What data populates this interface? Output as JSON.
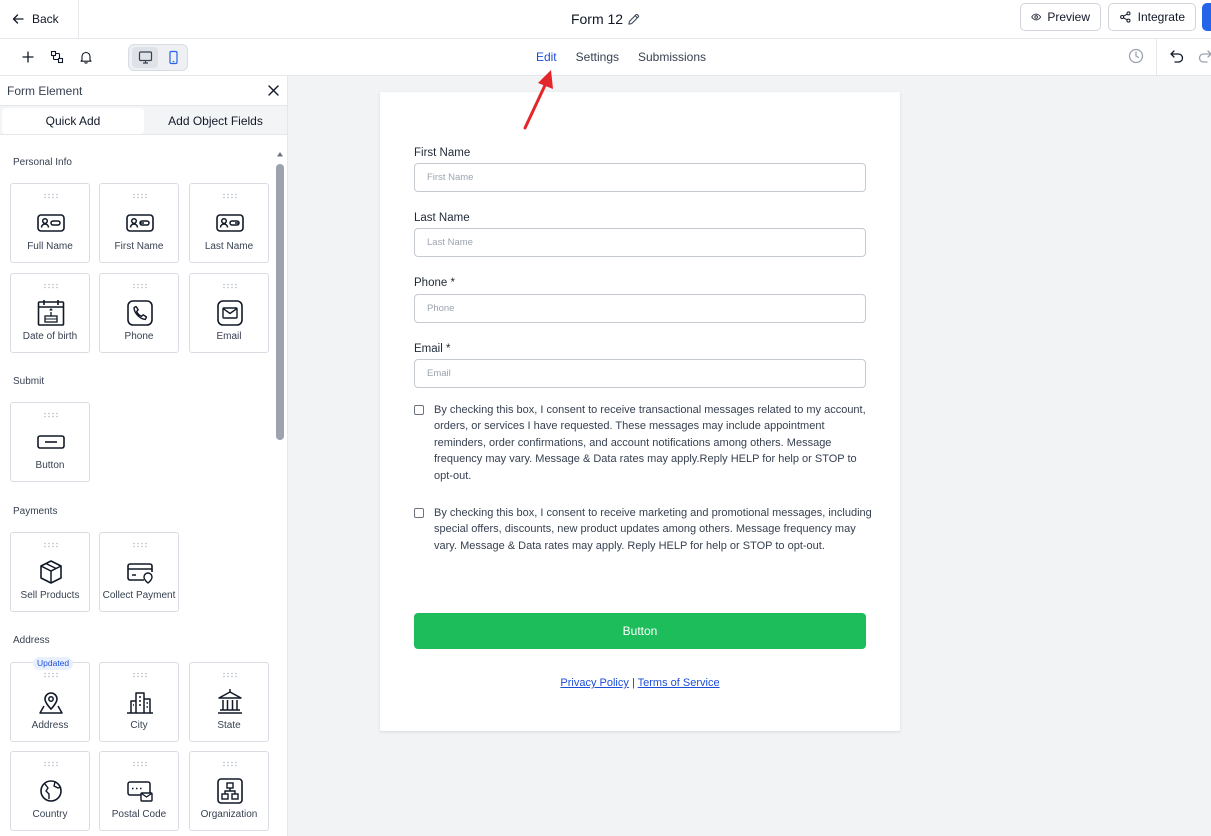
{
  "topbar": {
    "back_label": "Back",
    "form_title": "Form 12",
    "preview_label": "Preview",
    "integrate_label": "Integrate"
  },
  "toolbar": {
    "tabs": [
      "Edit",
      "Settings",
      "Submissions"
    ],
    "active_tab": "Edit"
  },
  "sidebar": {
    "title": "Form Element",
    "tabs": [
      "Quick Add",
      "Add Object Fields"
    ],
    "sections": {
      "personal_info": "Personal Info",
      "submit": "Submit",
      "payments": "Payments",
      "address": "Address"
    },
    "items": {
      "full_name": "Full Name",
      "first_name": "First Name",
      "last_name": "Last Name",
      "date_of_birth": "Date of birth",
      "phone": "Phone",
      "email": "Email",
      "button": "Button",
      "sell_products": "Sell Products",
      "collect_payment": "Collect Payment",
      "address": "Address",
      "city": "City",
      "state": "State",
      "country": "Country",
      "postal_code": "Postal Code",
      "organization": "Organization"
    },
    "address_badge": "Updated"
  },
  "form": {
    "fields": [
      {
        "label": "First Name",
        "placeholder": "First Name"
      },
      {
        "label": "Last Name",
        "placeholder": "Last Name"
      },
      {
        "label": "Phone *",
        "placeholder": "Phone"
      },
      {
        "label": "Email *",
        "placeholder": "Email"
      }
    ],
    "consent_transactional": "By checking this box, I consent to receive transactional messages related to my account, orders, or services I have requested. These messages may include appointment reminders, order confirmations, and account notifications among others. Message frequency may vary. Message & Data rates may apply.Reply HELP for help or STOP to opt-out.",
    "consent_marketing": "By checking this box, I consent to receive marketing and promotional messages, including special offers, discounts, new product updates among others. Message frequency may vary. Message & Data rates may apply. Reply HELP for help or STOP to opt-out.",
    "button_label": "Button",
    "privacy_label": "Privacy Policy",
    "separator": "|",
    "terms_label": "Terms of Service"
  },
  "colors": {
    "accent": "#1d4ed8",
    "submit_green": "#1cbd5a",
    "annotation_red": "#e3262a"
  }
}
